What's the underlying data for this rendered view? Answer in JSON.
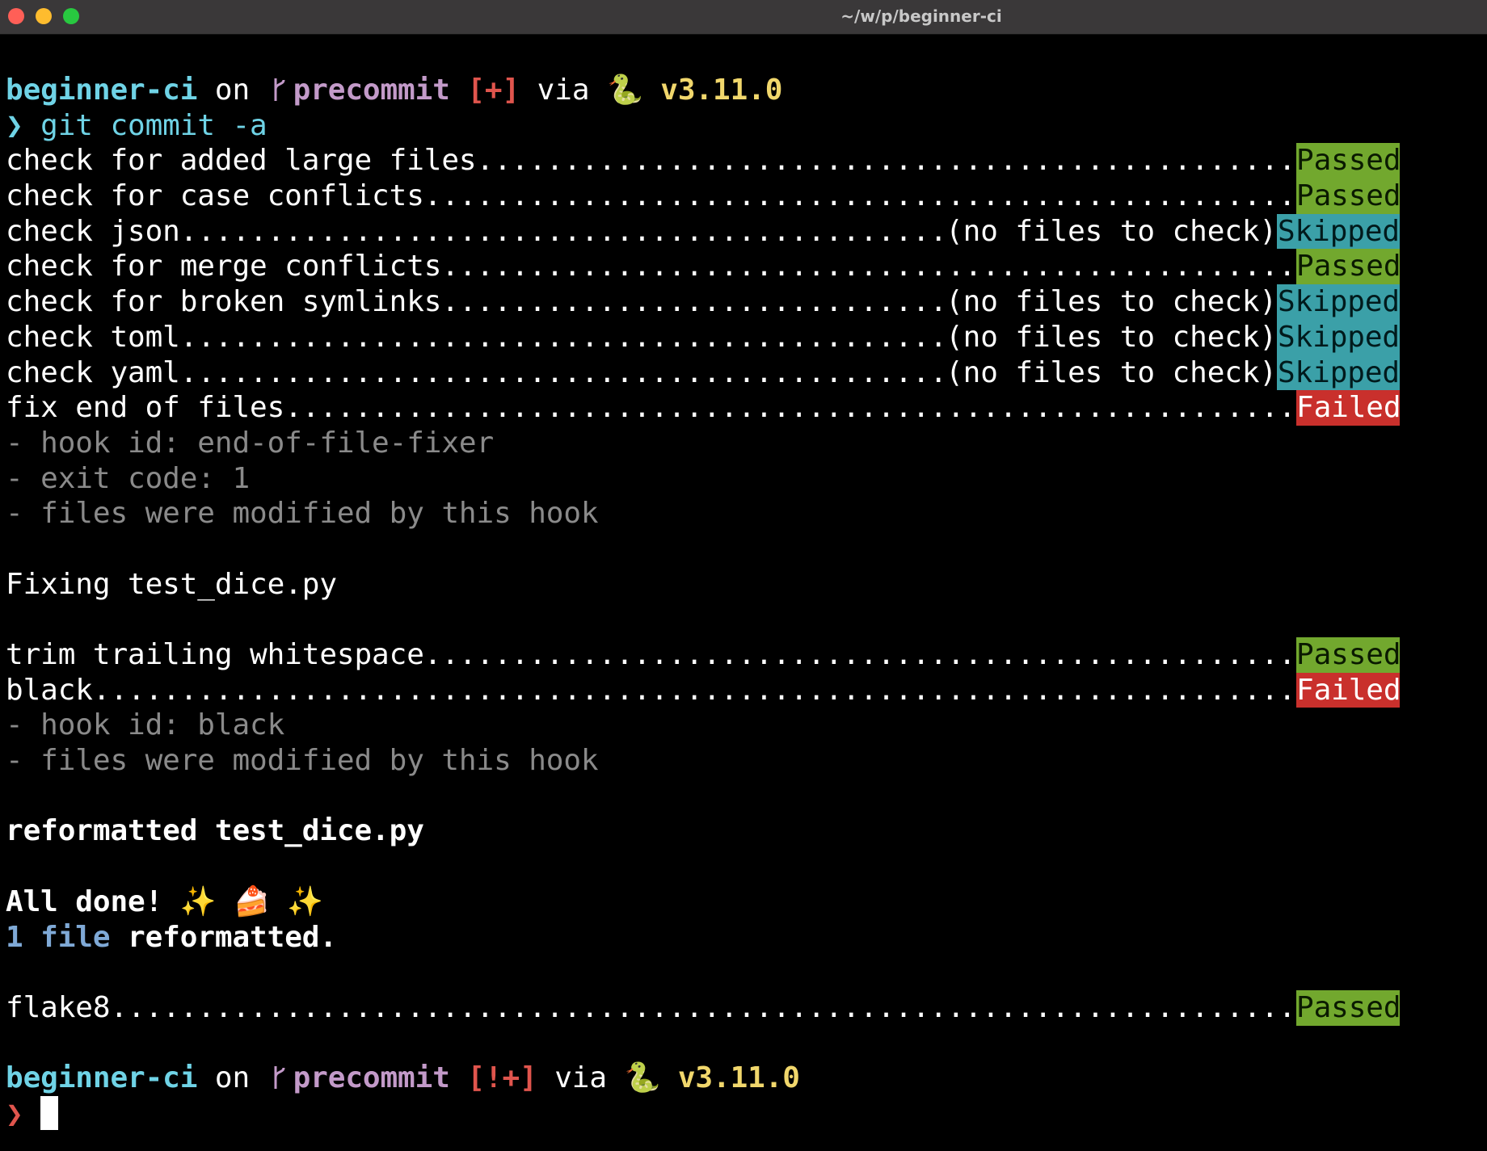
{
  "window": {
    "title": "~/w/p/beginner-ci"
  },
  "prompt1": {
    "dir": "beginner-ci",
    "on": " on ",
    "branch": "precommit",
    "status": "[+]",
    "via": " via ",
    "python_icon": "🐍",
    "version": "v3.11.0",
    "chevron": "❯",
    "command": " git commit -a"
  },
  "checks1": [
    {
      "label": "check for added large files",
      "note": "",
      "status": "Passed"
    },
    {
      "label": "check for case conflicts",
      "note": "",
      "status": "Passed"
    },
    {
      "label": "check json",
      "note": "(no files to check)",
      "status": "Skipped"
    },
    {
      "label": "check for merge conflicts",
      "note": "",
      "status": "Passed"
    },
    {
      "label": "check for broken symlinks",
      "note": "(no files to check)",
      "status": "Skipped"
    },
    {
      "label": "check toml",
      "note": "(no files to check)",
      "status": "Skipped"
    },
    {
      "label": "check yaml",
      "note": "(no files to check)",
      "status": "Skipped"
    },
    {
      "label": "fix end of files",
      "note": "",
      "status": "Failed"
    }
  ],
  "eof_details": [
    "- hook id: end-of-file-fixer",
    "- exit code: 1",
    "- files were modified by this hook"
  ],
  "fixing_line": "Fixing test_dice.py",
  "checks2": [
    {
      "label": "trim trailing whitespace",
      "note": "",
      "status": "Passed"
    },
    {
      "label": "black",
      "note": "",
      "status": "Failed"
    }
  ],
  "black_details": [
    "- hook id: black",
    "- files were modified by this hook"
  ],
  "reformatted_line": "reformatted test_dice.py",
  "all_done": {
    "text": "All done! ",
    "emoji": "✨ 🍰 ✨"
  },
  "summary": {
    "count": "1 file",
    "rest": " reformatted."
  },
  "checks3": [
    {
      "label": "flake8",
      "note": "",
      "status": "Passed"
    }
  ],
  "prompt2": {
    "dir": "beginner-ci",
    "on": " on ",
    "branch": "precommit",
    "status": "[!+]",
    "via": " via ",
    "python_icon": "🐍",
    "version": "v3.11.0",
    "chevron": "❯"
  },
  "colors": {
    "passed": "#72a82e",
    "skipped": "#3ba0a8",
    "failed": "#c9302c",
    "dir": "#6fd3e6",
    "branch": "#c39ac9",
    "version": "#f1d76c"
  }
}
